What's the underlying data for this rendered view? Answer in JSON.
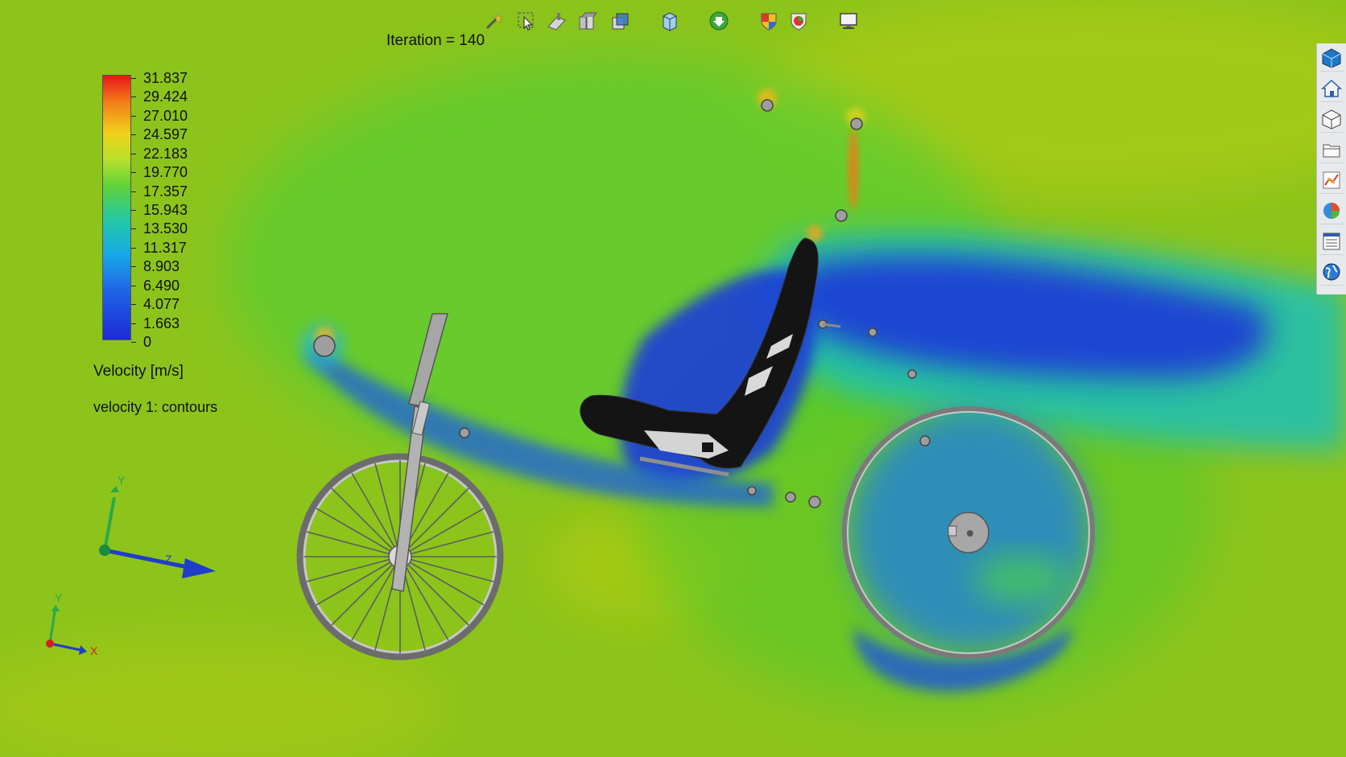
{
  "iteration_text": "Iteration = 140",
  "legend": {
    "ticks": [
      "31.837",
      "29.424",
      "27.010",
      "24.597",
      "22.183",
      "19.770",
      "17.357",
      "15.943",
      "13.530",
      "11.317",
      "8.903",
      "6.490",
      "4.077",
      "1.663",
      "0"
    ],
    "title": "Velocity [m/s]",
    "subtitle": "velocity 1: contours"
  },
  "triad_large": {
    "y_label": "Y",
    "z_label": "Z"
  },
  "triad_small": {
    "y_label": "Y",
    "x_label": "X"
  },
  "toolbar_top": [
    {
      "name": "magic-wand-icon"
    },
    {
      "name": "select-icon"
    },
    {
      "name": "plane-icon"
    },
    {
      "name": "section-view-icon"
    },
    {
      "name": "copy-view-icon"
    },
    {
      "name": "box-view-icon"
    },
    {
      "name": "download-icon"
    },
    {
      "name": "shield-badge-icon"
    },
    {
      "name": "chart-badge-icon"
    },
    {
      "name": "display-icon"
    }
  ],
  "toolbar_right": [
    {
      "name": "cube-icon"
    },
    {
      "name": "home-icon"
    },
    {
      "name": "wireframe-cube-icon"
    },
    {
      "name": "folder-icon"
    },
    {
      "name": "graph-icon"
    },
    {
      "name": "pie-chart-icon"
    },
    {
      "name": "list-icon"
    },
    {
      "name": "globe-icon"
    }
  ],
  "colors": {
    "background": "#8cc41c",
    "low_velocity": "#1c2bd6",
    "high_velocity": "#e8161a",
    "bike_metal": "#9b9b9b",
    "seat": "#141414"
  }
}
